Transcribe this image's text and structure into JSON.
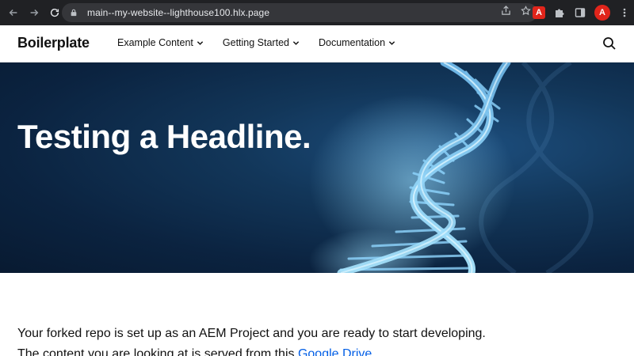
{
  "browser": {
    "url": "main--my-website--lighthouse100.hlx.page",
    "extension_adobe_label": "A",
    "profile_initial": "A"
  },
  "header": {
    "brand": "Boilerplate",
    "nav": [
      {
        "label": "Example Content"
      },
      {
        "label": "Getting Started"
      },
      {
        "label": "Documentation"
      }
    ]
  },
  "hero": {
    "title": "Testing a Headline."
  },
  "content": {
    "line1": "Your forked repo is set up as an AEM Project and you are ready to start developing.",
    "line2_prefix": "The content you are looking at is served from this ",
    "line2_link": "Google Drive"
  },
  "colors": {
    "chrome_bg": "#202124",
    "link": "#035fe6",
    "hero_dark": "#081a31",
    "dna_glow": "#7fd3ff"
  }
}
